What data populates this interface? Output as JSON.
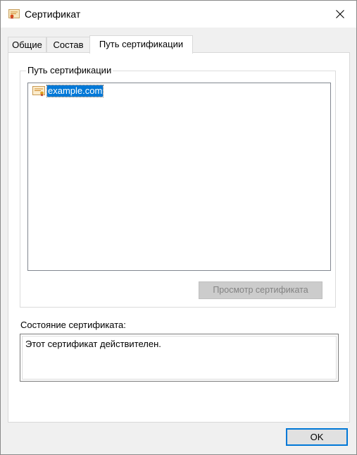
{
  "window": {
    "title": "Сертификат"
  },
  "tabs": [
    {
      "label": "Общие"
    },
    {
      "label": "Состав"
    },
    {
      "label": "Путь сертификации",
      "active": true
    }
  ],
  "cert_path": {
    "group_label": "Путь сертификации",
    "items": [
      {
        "label": "example.com",
        "icon": "certificate-icon",
        "selected": true
      }
    ],
    "view_button": {
      "label": "Просмотр сертификата",
      "disabled": true
    }
  },
  "status": {
    "label": "Состояние сертификата:",
    "text": "Этот сертификат действителен."
  },
  "footer": {
    "ok_label": "OK"
  },
  "colors": {
    "selection": "#0078d7",
    "focus_border": "#0078d7",
    "dialog_bg": "#f0f0f0"
  }
}
